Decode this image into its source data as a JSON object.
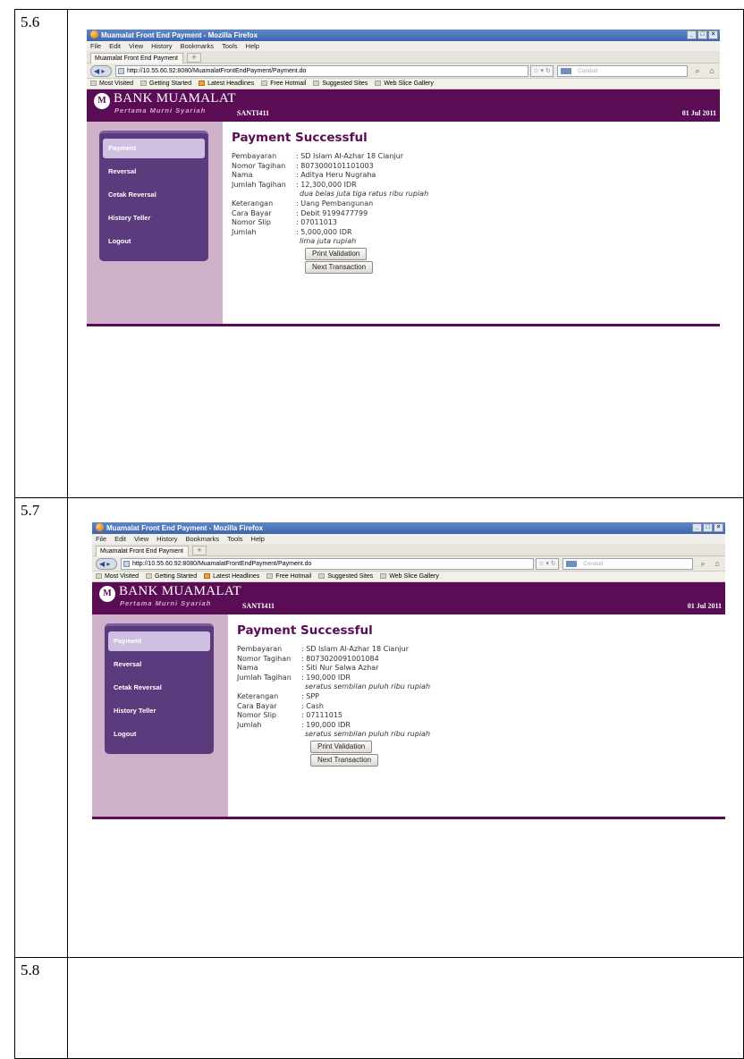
{
  "rows": [
    {
      "number": "5.6"
    },
    {
      "number": "5.7"
    },
    {
      "number": "5.8"
    }
  ],
  "browser": {
    "window_title": "Muamalat Front End Payment - Mozilla Firefox",
    "menu": [
      "File",
      "Edit",
      "View",
      "History",
      "Bookmarks",
      "Tools",
      "Help"
    ],
    "tab_title": "Muamalat Front End Payment",
    "new_tab": "+",
    "url": "http://10.55.60.92:8080/MuamalatFrontEndPayment/Payment.do",
    "search_placeholder": "Conduit",
    "bookmarks": [
      "Most Visited",
      "Getting Started",
      "Latest Headlines",
      "Free Hotmail",
      "Suggested Sites",
      "Web Slice Gallery"
    ]
  },
  "app": {
    "logo_text": "BANK MUAMALAT",
    "logo_tagline": "Pertama Murni Syariah",
    "user": "SANTI411",
    "date": "01 Jul 2011",
    "menu": [
      "Payment",
      "Reversal",
      "Cetak Reversal",
      "History Teller",
      "Logout"
    ]
  },
  "screens": [
    {
      "title": "Payment Successful",
      "fields": {
        "pembayaran": {
          "label": "Pembayaran",
          "value": ": SD Islam Al-Azhar 18 Cianjur"
        },
        "nomor_tagihan": {
          "label": "Nomor Tagihan",
          "value": ": 8073000101101003"
        },
        "nama": {
          "label": "Nama",
          "value": ": Aditya Heru Nugraha"
        },
        "jumlah_tagihan": {
          "label": "Jumlah Tagihan",
          "value": ": 12,300,000 IDR"
        },
        "jumlah_tagihan_words": "dua belas juta tiga ratus ribu rupiah",
        "keterangan": {
          "label": "Keterangan",
          "value": ": Uang Pembangunan"
        },
        "cara_bayar": {
          "label": "Cara Bayar",
          "value": ": Debit 9199477799"
        },
        "nomor_slip": {
          "label": "Nomor Slip",
          "value": ": 07011013"
        },
        "jumlah": {
          "label": "Jumlah",
          "value": ": 5,000,000 IDR"
        },
        "jumlah_words": "lima juta rupiah"
      },
      "buttons": {
        "print": "Print Validation",
        "next": "Next Transaction"
      }
    },
    {
      "title": "Payment Successful",
      "fields": {
        "pembayaran": {
          "label": "Pembayaran",
          "value": ": SD Islam Al-Azhar 18 Cianjur"
        },
        "nomor_tagihan": {
          "label": "Nomor Tagihan",
          "value": ": 8073020091001084"
        },
        "nama": {
          "label": "Nama",
          "value": ": Siti Nur Salwa Azhar"
        },
        "jumlah_tagihan": {
          "label": "Jumlah Tagihan",
          "value": ": 190,000 IDR"
        },
        "jumlah_tagihan_words": "seratus sembilan puluh ribu rupiah",
        "keterangan": {
          "label": "Keterangan",
          "value": ": SPP"
        },
        "cara_bayar": {
          "label": "Cara Bayar",
          "value": ": Cash"
        },
        "nomor_slip": {
          "label": "Nomor Slip",
          "value": ": 07111015"
        },
        "jumlah": {
          "label": "Jumlah",
          "value": ": 190,000 IDR"
        },
        "jumlah_words": "seratus sembilan puluh ribu rupiah"
      },
      "buttons": {
        "print": "Print Validation",
        "next": "Next Transaction"
      }
    }
  ]
}
